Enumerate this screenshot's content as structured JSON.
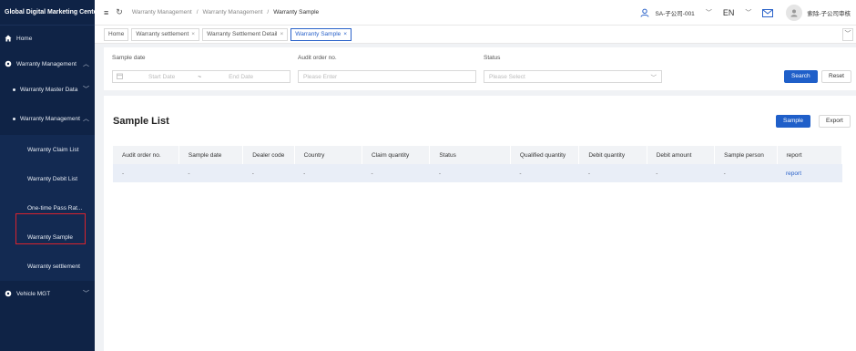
{
  "app": {
    "title": "Global Digital Marketing Center"
  },
  "sidebar": {
    "home": "Home",
    "warranty_management": "Warranty Management",
    "master_data": "Warranty Master Data",
    "sub_management": "Warranty Management",
    "leaves": [
      "Warranty Claim List",
      "Warranty Debit List",
      "One-time Pass Rat...",
      "Warranty Sample",
      "Warranty settlement"
    ],
    "vehicle_mgt": "Vehicle MGT"
  },
  "header": {
    "breadcrumb": [
      "Warranty Management",
      "Warranty Management",
      "Warranty Sample"
    ],
    "org": "SA-子公司-001",
    "lang": "EN",
    "user": "索除-子公司审核"
  },
  "tabs": [
    "Home",
    "Warranty settlement",
    "Warranty Settlement Detail",
    "Warranty Sample"
  ],
  "filter": {
    "sample_date_label": "Sample date",
    "start_placeholder": "Start Date",
    "range_sep": "~",
    "end_placeholder": "End Date",
    "audit_label": "Audit order no.",
    "audit_placeholder": "Please Enter",
    "status_label": "Status",
    "status_placeholder": "Please Select",
    "search": "Search",
    "reset": "Reset"
  },
  "list": {
    "title": "Sample List",
    "sample_btn": "Sample",
    "export_btn": "Export",
    "columns": [
      "Audit order no.",
      "Sample date",
      "Dealer code",
      "Country",
      "Claim quantity",
      "Status",
      "Qualified quantity",
      "Debit quantity",
      "Debit amount",
      "Sample person",
      "report"
    ],
    "rows": [
      [
        "-",
        "-",
        "-",
        "-",
        "-",
        "-",
        "-",
        "-",
        "-",
        "-",
        "report"
      ]
    ]
  },
  "colors": {
    "accent": "#1f5fc9",
    "sidebar": "#0f2346",
    "highlight": "#d9232d"
  }
}
